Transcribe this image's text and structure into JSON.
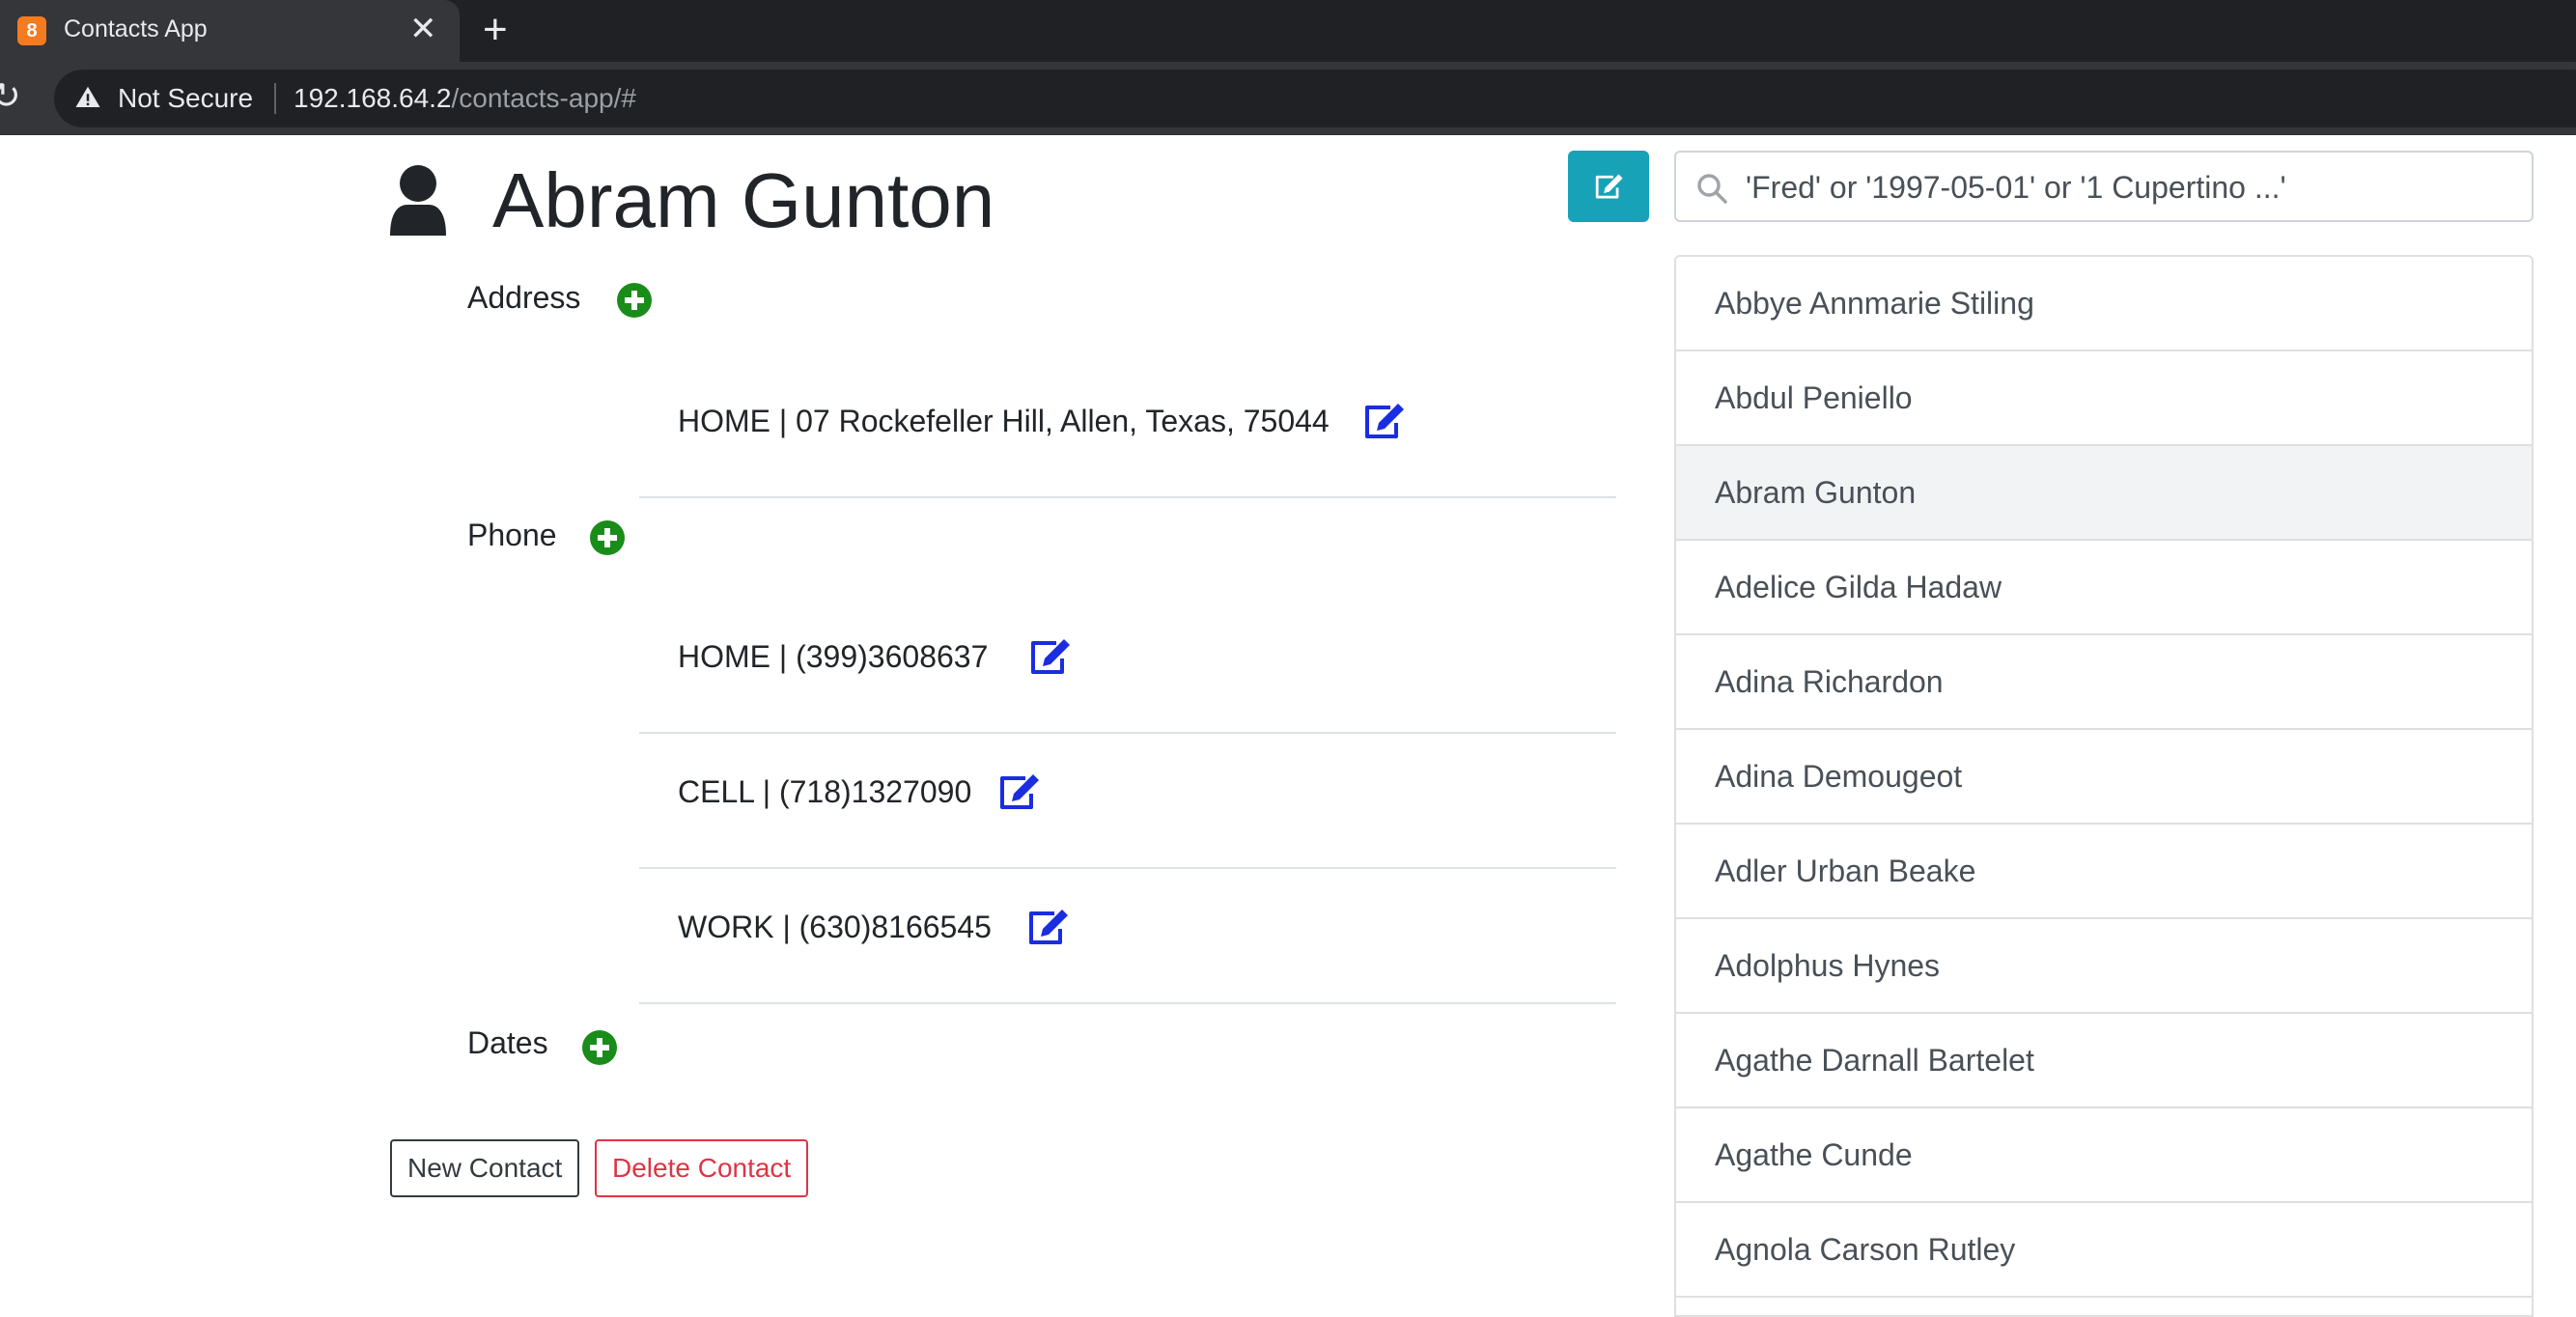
{
  "browser": {
    "tab_title": "Contacts App",
    "favicon_text": "8",
    "security_label": "Not Secure",
    "url_host": "192.168.64.2",
    "url_path": "/contacts-app/#"
  },
  "contact": {
    "name": "Abram Gunton",
    "sections": {
      "address_label": "Address",
      "phone_label": "Phone",
      "dates_label": "Dates"
    },
    "addresses": [
      {
        "text": "HOME | 07 Rockefeller Hill, Allen, Texas, 75044"
      }
    ],
    "phones": [
      {
        "text": "HOME | (399)3608637"
      },
      {
        "text": "CELL | (718)1327090"
      },
      {
        "text": "WORK | (630)8166545"
      }
    ]
  },
  "actions": {
    "new_contact": "New Contact",
    "delete_contact": "Delete Contact"
  },
  "search": {
    "placeholder": "'Fred' or '1997-05-01' or '1 Cupertino ...'"
  },
  "contact_list": {
    "selected": "Abram Gunton",
    "items": [
      "Abbye Annmarie Stiling",
      "Abdul Peniello",
      "Abram Gunton",
      "Adelice Gilda Hadaw",
      "Adina Richardon",
      "Adina Demougeot",
      "Adler Urban Beake",
      "Adolphus Hynes",
      "Agathe Darnall Bartelet",
      "Agathe Cunde",
      "Agnola Carson Rutley"
    ]
  },
  "colors": {
    "add_icon": "#198c19",
    "edit_icon": "#1a2de0",
    "edit_button_bg": "#17a2b8",
    "delete_red": "#dc3545"
  },
  "icons": {
    "person": "person-icon",
    "add": "plus-circle-icon",
    "edit": "edit-icon",
    "search": "search-icon"
  }
}
